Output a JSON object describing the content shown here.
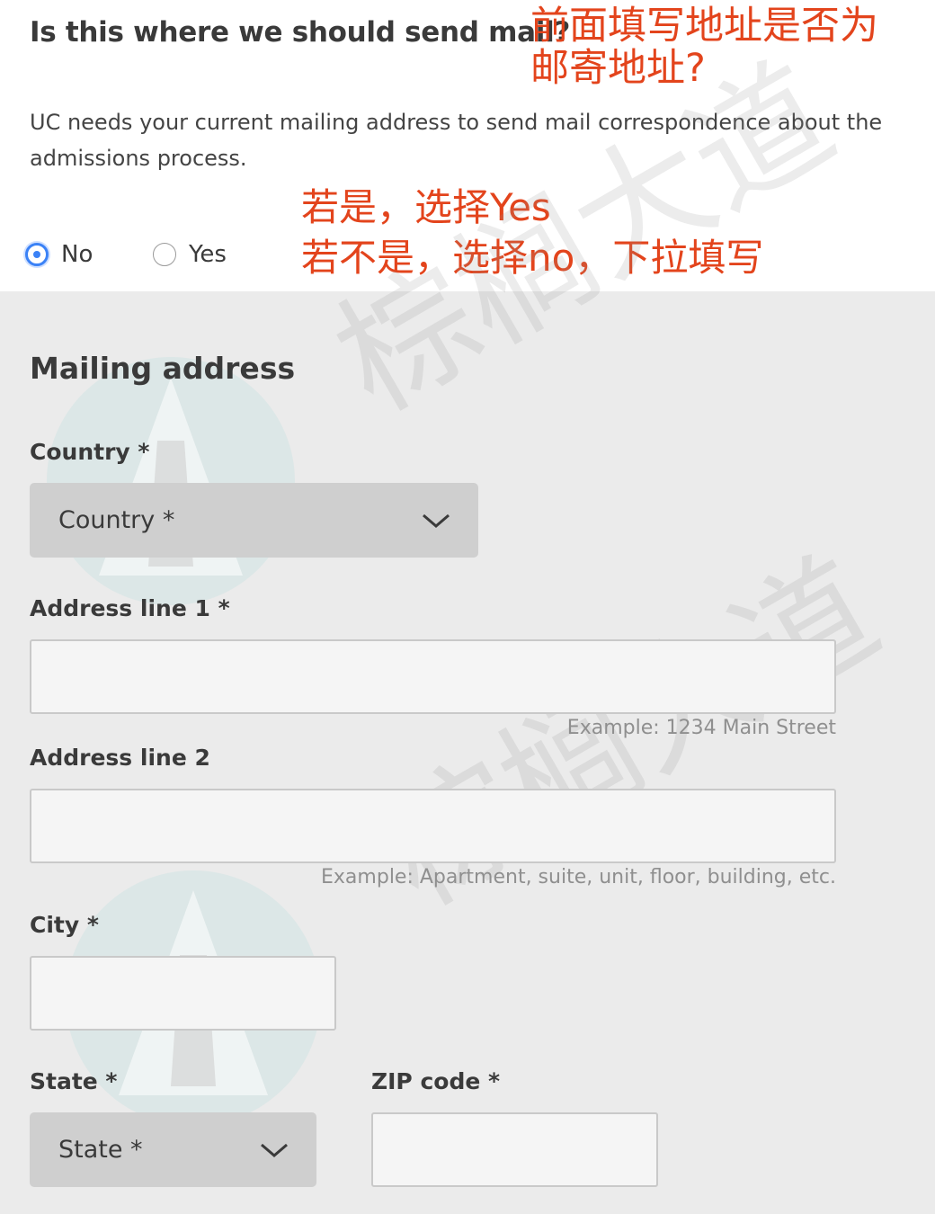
{
  "question": {
    "title": "Is this where we should send mail?",
    "description": "UC needs your current mailing address to send mail correspondence about the admissions process."
  },
  "annotations": {
    "line1": "前面填写地址是否为",
    "line2": "邮寄地址?",
    "line3": "若是，选择Yes",
    "line4": "若不是，选择no，下拉填写"
  },
  "radio": {
    "no_label": "No",
    "yes_label": "Yes",
    "selected": "No"
  },
  "mailing": {
    "title": "Mailing address",
    "country_label": "Country *",
    "country_value": "Country *",
    "address1_label": "Address line 1 *",
    "address1_value": "",
    "address1_hint": "Example: 1234 Main Street",
    "address2_label": "Address line 2",
    "address2_value": "",
    "address2_hint": "Example: Apartment, suite, unit, floor, building, etc.",
    "city_label": "City *",
    "city_value": "",
    "state_label": "State *",
    "state_value": "State *",
    "zip_label": "ZIP code *",
    "zip_value": ""
  },
  "watermark": {
    "text": "棕榈大道"
  },
  "colors": {
    "annotation": "#e3441c",
    "radio_accent": "#3b82f6",
    "select_bg": "#cfcfcf",
    "panel_bg": "#ebebeb"
  },
  "icons": [
    "chevron-down-icon",
    "radio-selected-icon",
    "radio-unselected-icon",
    "watermark-logo-icon"
  ]
}
